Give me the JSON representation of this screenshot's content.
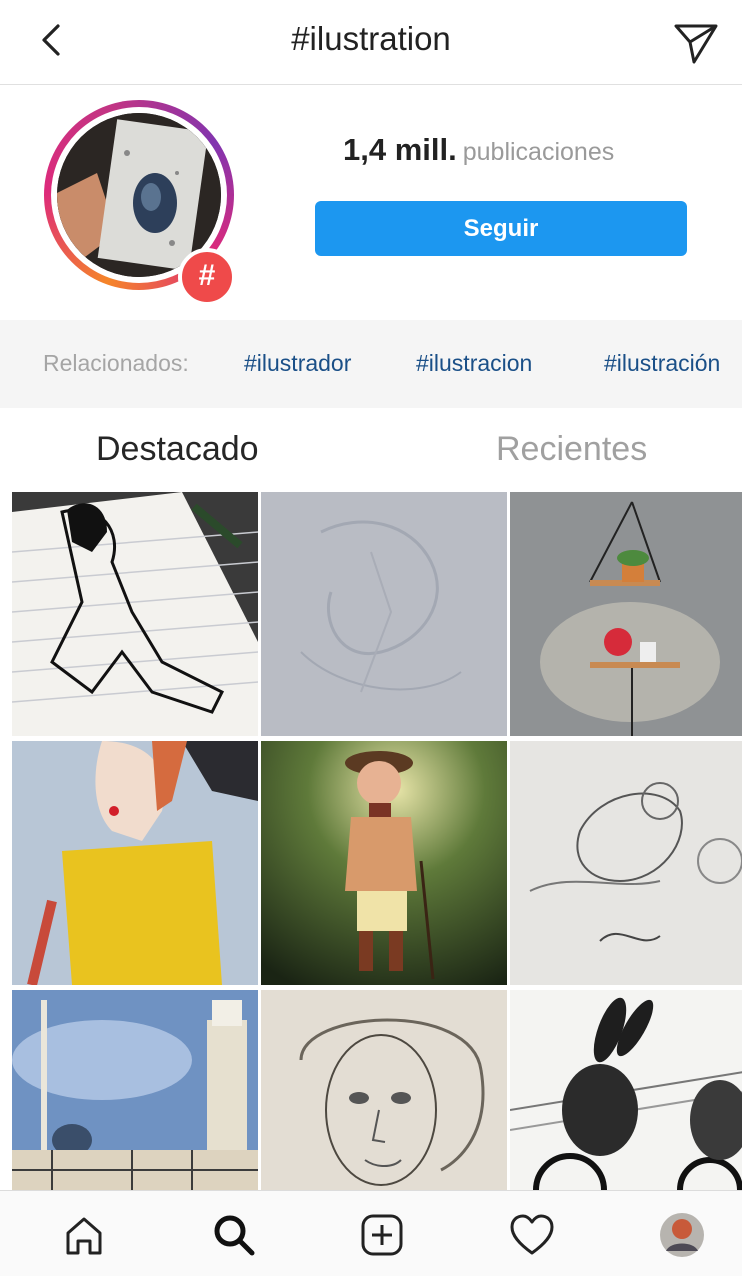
{
  "header": {
    "title": "#ilustration"
  },
  "profile": {
    "count": "1,4 mill.",
    "count_label": "publicaciones",
    "follow_label": "Seguir",
    "badge": "#"
  },
  "related": {
    "label": "Relacionados:",
    "tags": [
      "#ilustrador",
      "#ilustracion",
      "#ilustración"
    ]
  },
  "tabs": [
    "Destacado",
    "Recientes"
  ],
  "grid": {
    "posts": [
      "lined-paper-ink-sketch",
      "faint-pencil-sketch",
      "hanging-plant-shelf",
      "woman-yellow-shirt-painting",
      "boy-with-cane-digital-art",
      "sleeping-girl-pencil-sketch",
      "city-tower-watercolor",
      "woman-portrait-pencil",
      "rabbits-on-bicycles-ink"
    ]
  },
  "bottom_nav": [
    "home-icon",
    "search-icon",
    "add-post-icon",
    "heart-icon",
    "profile-avatar"
  ],
  "colors": {
    "accent_blue": "#1c97f0",
    "tag_blue": "#1a4f87",
    "badge_red": "#ef4a4a"
  }
}
